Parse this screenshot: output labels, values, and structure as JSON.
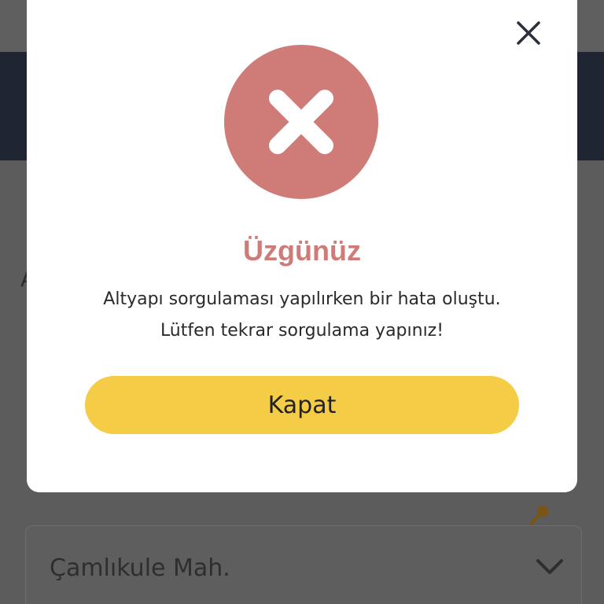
{
  "background": {
    "select_value": "Çamlıkule Mah.",
    "fragment_text": "A",
    "icons": [
      "pin-icon",
      "chevron-down-icon"
    ]
  },
  "dialog": {
    "title": "Üzgünüz",
    "message_line1": "Altyapı sorgulaması yapılırken bir hata oluştu.",
    "message_line2": "Lütfen tekrar sorgulama yapınız!",
    "button_label": "Kapat",
    "icons": [
      "close-icon",
      "error-x-icon"
    ]
  },
  "colors": {
    "error": "#cf7b78",
    "button": "#f5cc46",
    "header_band": "#1f2533"
  }
}
